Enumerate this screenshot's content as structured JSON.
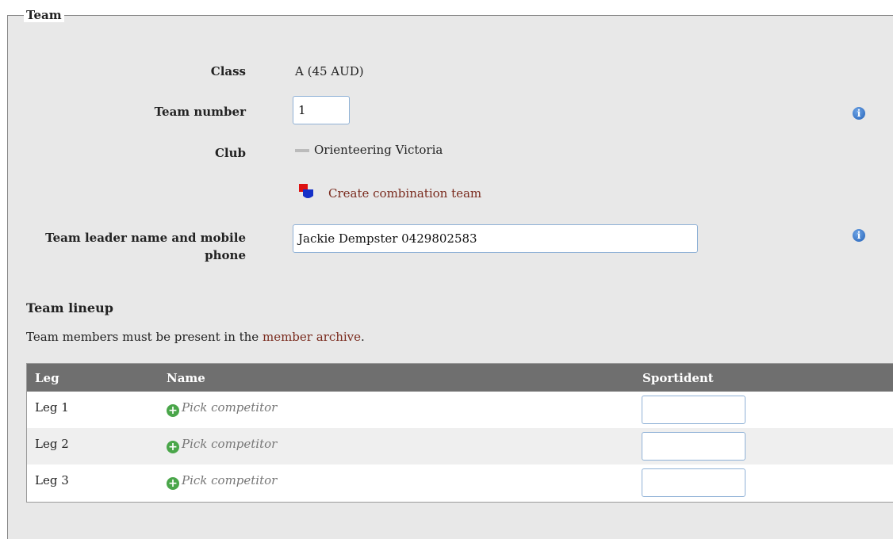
{
  "fieldset": {
    "legend": "Team"
  },
  "form": {
    "class_label": "Class",
    "class_value": "A (45 AUD)",
    "team_number_label": "Team number",
    "team_number_value": "1",
    "club_label": "Club",
    "club_value": "Orienteering Victoria",
    "create_combination_label": "Create combination team",
    "leader_label_line1": "Team leader name and mobile",
    "leader_label_line2": "phone",
    "leader_value": "Jackie Dempster 0429802583",
    "info_glyph": "i"
  },
  "lineup": {
    "heading": "Team lineup",
    "note_prefix": "Team members must be present in the ",
    "note_link": "member archive",
    "note_suffix": ".",
    "columns": {
      "leg": "Leg",
      "name": "Name",
      "si": "Sportident"
    },
    "rows": [
      {
        "leg": "Leg 1",
        "name": "Pick competitor",
        "si": ""
      },
      {
        "leg": "Leg 2",
        "name": "Pick competitor",
        "si": ""
      },
      {
        "leg": "Leg 3",
        "name": "Pick competitor",
        "si": ""
      }
    ],
    "plus_glyph": "+"
  },
  "colors": {
    "panel_bg": "#e8e8e8",
    "header_bg": "#6f6f6f",
    "link": "#7a2b1e",
    "info_icon": "#2462b8",
    "plus_icon": "#4aa64a"
  }
}
